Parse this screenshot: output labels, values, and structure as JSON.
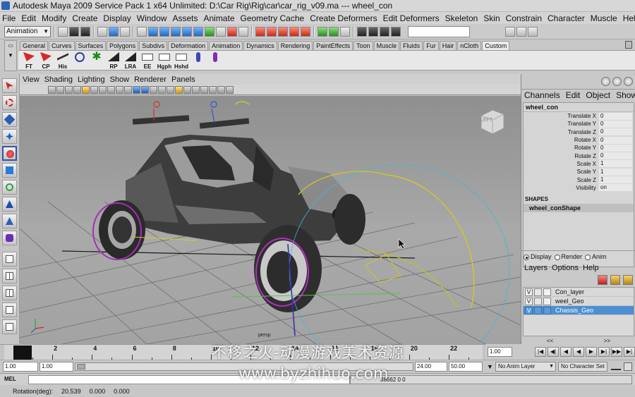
{
  "window": {
    "title": "Autodesk Maya 2009 Service Pack 1 x64 Unlimited: D:\\Car Rig\\Rig\\car\\car_rig_v09.ma   ---   wheel_con"
  },
  "menubar": [
    "File",
    "Edit",
    "Modify",
    "Create",
    "Display",
    "Window",
    "Assets",
    "Animate",
    "Geometry Cache",
    "Create Deformers",
    "Edit Deformers",
    "Skeleton",
    "Skin",
    "Constrain",
    "Character",
    "Muscle",
    "Help"
  ],
  "statusline": {
    "mode": "Animation"
  },
  "shelf": {
    "tabs": [
      "General",
      "Curves",
      "Surfaces",
      "Polygons",
      "Subdivs",
      "Deformation",
      "Animation",
      "Dynamics",
      "Rendering",
      "PaintEffects",
      "Toon",
      "Muscle",
      "Fluids",
      "Fur",
      "Hair",
      "nCloth",
      "Custom"
    ],
    "active_tab": "Custom",
    "buttons": [
      {
        "label": "FT",
        "icon": "red-arrow-icon"
      },
      {
        "label": "CP",
        "icon": "red-arrow-icon"
      },
      {
        "label": "His",
        "icon": "history-icon"
      },
      {
        "label": "",
        "icon": "circle-icon"
      },
      {
        "label": "",
        "icon": "star-icon"
      },
      {
        "label": "RP",
        "icon": "rotate-pivot-icon"
      },
      {
        "label": "LRA",
        "icon": "local-axis-icon"
      },
      {
        "label": "EE",
        "icon": "end-effector-icon"
      },
      {
        "label": "Hgph",
        "icon": "hypergraph-icon"
      },
      {
        "label": "Hshd",
        "icon": "hypershade-icon"
      },
      {
        "label": "",
        "icon": "joint-icon"
      },
      {
        "label": "",
        "icon": "ik-icon"
      }
    ]
  },
  "panel": {
    "menu": [
      "View",
      "Shading",
      "Lighting",
      "Show",
      "Renderer",
      "Panels"
    ],
    "camera_label": "persp",
    "viewcube_face": "LEFT"
  },
  "channel_box": {
    "menu": [
      "Channels",
      "Edit",
      "Object",
      "Show"
    ],
    "object": "wheel_con",
    "attributes": [
      {
        "name": "Translate X",
        "value": "0"
      },
      {
        "name": "Translate Y",
        "value": "0"
      },
      {
        "name": "Translate Z",
        "value": "0"
      },
      {
        "name": "Rotate X",
        "value": "0"
      },
      {
        "name": "Rotate Y",
        "value": "0"
      },
      {
        "name": "Rotate Z",
        "value": "0"
      },
      {
        "name": "Scale X",
        "value": "1"
      },
      {
        "name": "Scale Y",
        "value": "1"
      },
      {
        "name": "Scale Z",
        "value": "1"
      },
      {
        "name": "Visibility",
        "value": "on"
      }
    ],
    "shapes_header": "SHAPES",
    "shape_name": "wheel_conShape"
  },
  "layer_editor": {
    "modes": [
      {
        "label": "Display",
        "selected": true
      },
      {
        "label": "Render",
        "selected": false
      },
      {
        "label": "Anim",
        "selected": false
      }
    ],
    "menu": [
      "Layers",
      "Options",
      "Help"
    ],
    "layers": [
      {
        "v": "V",
        "name": "Con_layer",
        "selected": false
      },
      {
        "v": "V",
        "name": "weel_Geo",
        "selected": false
      },
      {
        "v": "V",
        "name": "Chassis_Geo",
        "selected": true
      }
    ],
    "scroll": [
      "<<",
      ">>"
    ]
  },
  "timeline": {
    "ticks": [
      "2",
      "4",
      "6",
      "8",
      "10",
      "12",
      "14",
      "16",
      "18",
      "20",
      "22",
      "24"
    ],
    "current_time": "1.00"
  },
  "range": {
    "start": "1.00",
    "playback_start": "1.00",
    "playback_end": "24.00",
    "end": "50.00",
    "anim_layer": "No Anim Layer",
    "character_set": "No Character Set"
  },
  "command_line": {
    "label": "MEL",
    "result": "38662 0 0"
  },
  "help_line": {
    "label": "Rotation(deg):",
    "values": [
      "20.539",
      "0.000",
      "0.000"
    ]
  },
  "watermark": {
    "line1": "不移之火-动漫游戏美术资源",
    "line2": "www.byzhihuo.com"
  }
}
